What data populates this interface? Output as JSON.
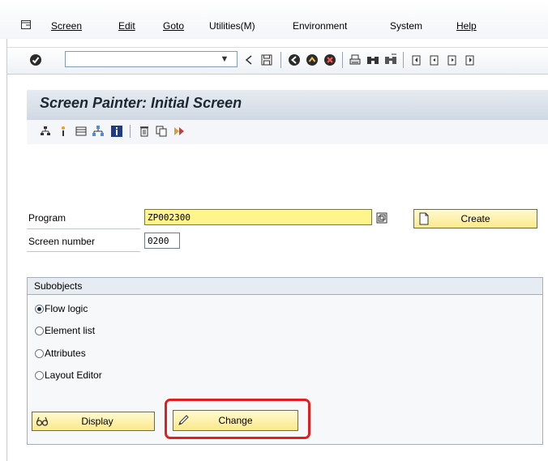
{
  "menu": {
    "items": [
      {
        "label": "Screen"
      },
      {
        "label": "Edit"
      },
      {
        "label": "Goto"
      },
      {
        "label": "Utilities(M)"
      },
      {
        "label": "Environment"
      },
      {
        "label": "System"
      },
      {
        "label": "Help"
      }
    ]
  },
  "toolbar": {
    "command_field_value": "",
    "icons": [
      "back-icon",
      "exit-icon",
      "cancel-icon",
      "print-icon",
      "find-icon",
      "find-next-icon",
      "first-page-icon",
      "previous-page-icon",
      "next-page-icon",
      "last-page-icon"
    ]
  },
  "title": "Screen Painter: Initial Screen",
  "form": {
    "program_label": "Program",
    "program_value": "ZP002300",
    "screen_number_label": "Screen number",
    "screen_number_value": "0200",
    "create_label": "Create"
  },
  "subobjects": {
    "title": "Subobjects",
    "options": [
      {
        "label": "Flow logic",
        "selected": true
      },
      {
        "label": "Element list",
        "selected": false
      },
      {
        "label": "Attributes",
        "selected": false
      },
      {
        "label": "Layout Editor",
        "selected": false
      }
    ]
  },
  "buttons": {
    "display_label": "Display",
    "change_label": "Change"
  },
  "colors": {
    "required_field": "#fff58a",
    "button_bg": "#fbe98b",
    "highlight": "#e0201e"
  }
}
